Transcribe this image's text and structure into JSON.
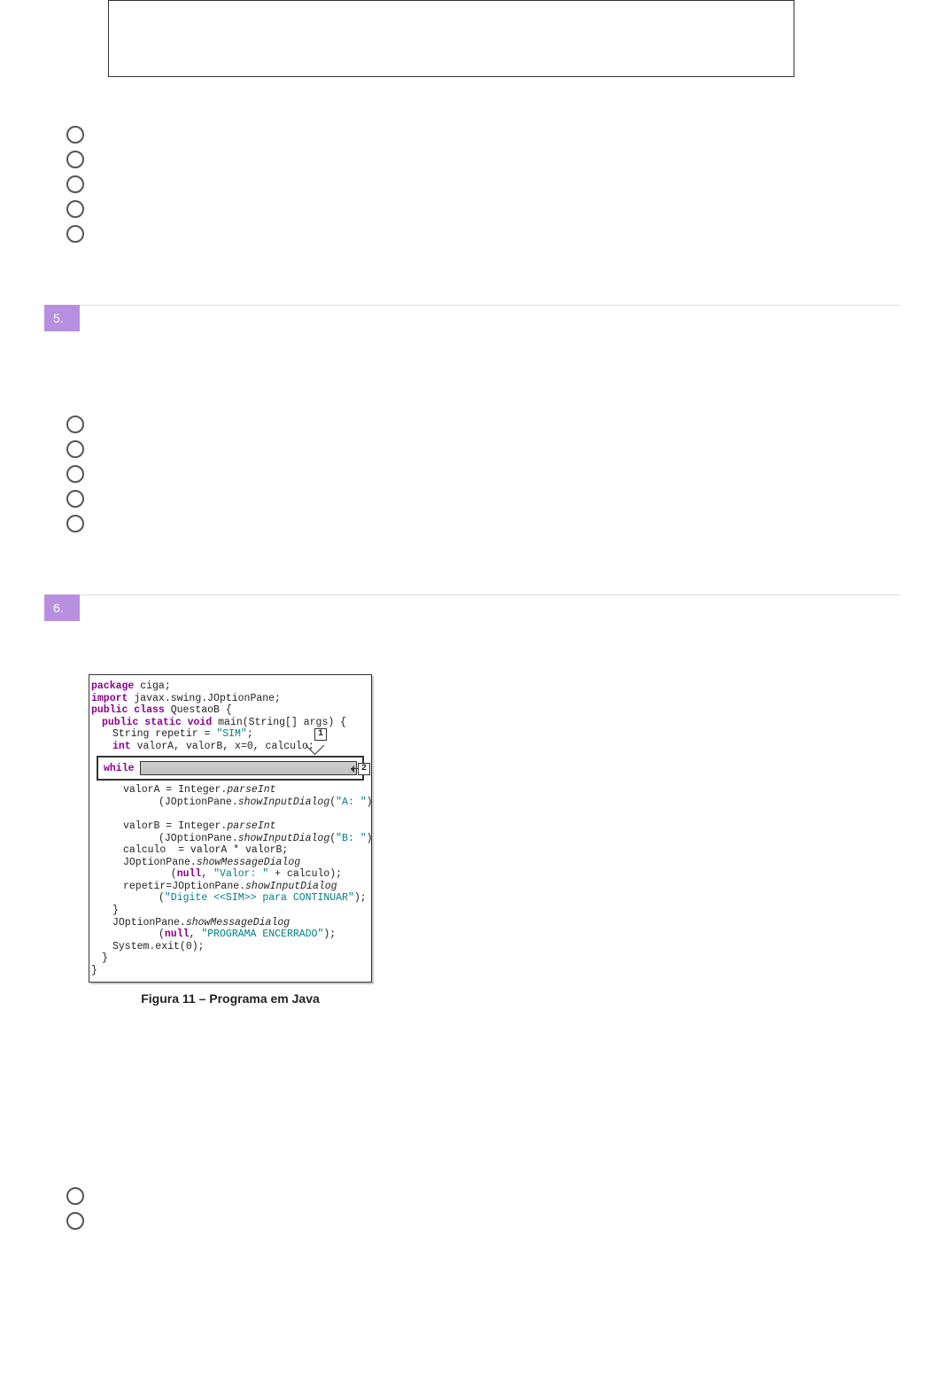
{
  "q4": {
    "options": [
      "",
      "",
      "",
      "",
      ""
    ]
  },
  "q5": {
    "number": "5.",
    "text": "",
    "options": [
      "",
      "",
      "",
      "",
      ""
    ]
  },
  "q6": {
    "number": "6.",
    "text": "",
    "caption": "Figura 11 – Programa em Java",
    "code": {
      "l01a": "package",
      "l01b": " ciga;",
      "l02a": "import",
      "l02b": " javax.swing.JOptionPane;",
      "l03a": "public class",
      "l03b": " QuestaoB {",
      "l04a": "public static void",
      "l04b": " main(String[] args) {",
      "l05a": "String repetir = ",
      "l05b": "\"SIM\"",
      "l05c": ";",
      "l06a": "int",
      "l06b": " valorA, valorB, x=0, calculo;",
      "l_while": "while",
      "l08": "valorA = Integer.parseInt",
      "l09a": "(JOptionPane.showInputDialog(",
      "l09b": "\"A: \"",
      "l09c": "));",
      "l10": "valorB = Integer.parseInt",
      "l11a": "(JOptionPane.showInputDialog(",
      "l11b": "\"B: \"",
      "l11c": "));",
      "l12": "calculo  = valorA * valorB;",
      "l13": "JOptionPane.showMessageDialog",
      "l14a": "(null, ",
      "l14b": "\"Valor: \"",
      "l14c": " + calculo);",
      "l15": "repetir=JOptionPane.showInputDialog",
      "l16a": "(",
      "l16b": "\"Digite <<SIM>> para CONTINUAR\"",
      "l16c": ");",
      "l17": "}",
      "l18": "JOptionPane.showMessageDialog",
      "l19a": "(null, ",
      "l19b": "\"PROGRAMA ENCERRADO\"",
      "l19c": ");",
      "l20": "System.exit(0);",
      "l21": "}",
      "l22": "}",
      "callout1": "1",
      "callout2": "2"
    },
    "options_bottom": [
      "",
      ""
    ]
  }
}
